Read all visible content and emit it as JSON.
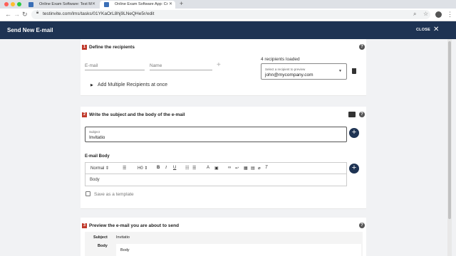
{
  "browser": {
    "tabs": [
      {
        "label": "Online Exam Software: Test M",
        "active": false
      },
      {
        "label": "Online Exam Software App: Cr",
        "active": true
      }
    ],
    "url": "testinvite.com/lms/tasks/01YKaOrL8hj9LNeQHe5r/edit"
  },
  "header": {
    "title": "Send New E-mail",
    "close_label": "CLOSE"
  },
  "section1": {
    "number": "1",
    "title": "Define the recipients",
    "email_placeholder": "E-mail",
    "name_placeholder": "Name",
    "recipients_loaded": "4 recipients loaded",
    "preview_label": "Select a recipient to preview",
    "preview_value": "john@mycompany.com",
    "add_multiple": "Add Multiple Recipients at once"
  },
  "section2": {
    "number": "2",
    "title": "Write the subject and the body of the e-mail",
    "subject_label": "Subject",
    "subject_value": "Invitatio",
    "body_heading": "E-mail Body",
    "toolbar": {
      "font": "Normal",
      "heading": "H0",
      "bold": "B",
      "italic": "I",
      "underline": "U"
    },
    "body_placeholder": "Body",
    "save_template": "Save as a template"
  },
  "section3": {
    "number": "3",
    "title": "Preview the e-mail you are about to send",
    "subject_key": "Subject",
    "subject_value": "Invitatio",
    "body_key": "Body",
    "body_value": "Body"
  },
  "colors": {
    "header": "#1e3353",
    "accent_red": "#c0392b",
    "tab_bar": "#dee1e6"
  }
}
